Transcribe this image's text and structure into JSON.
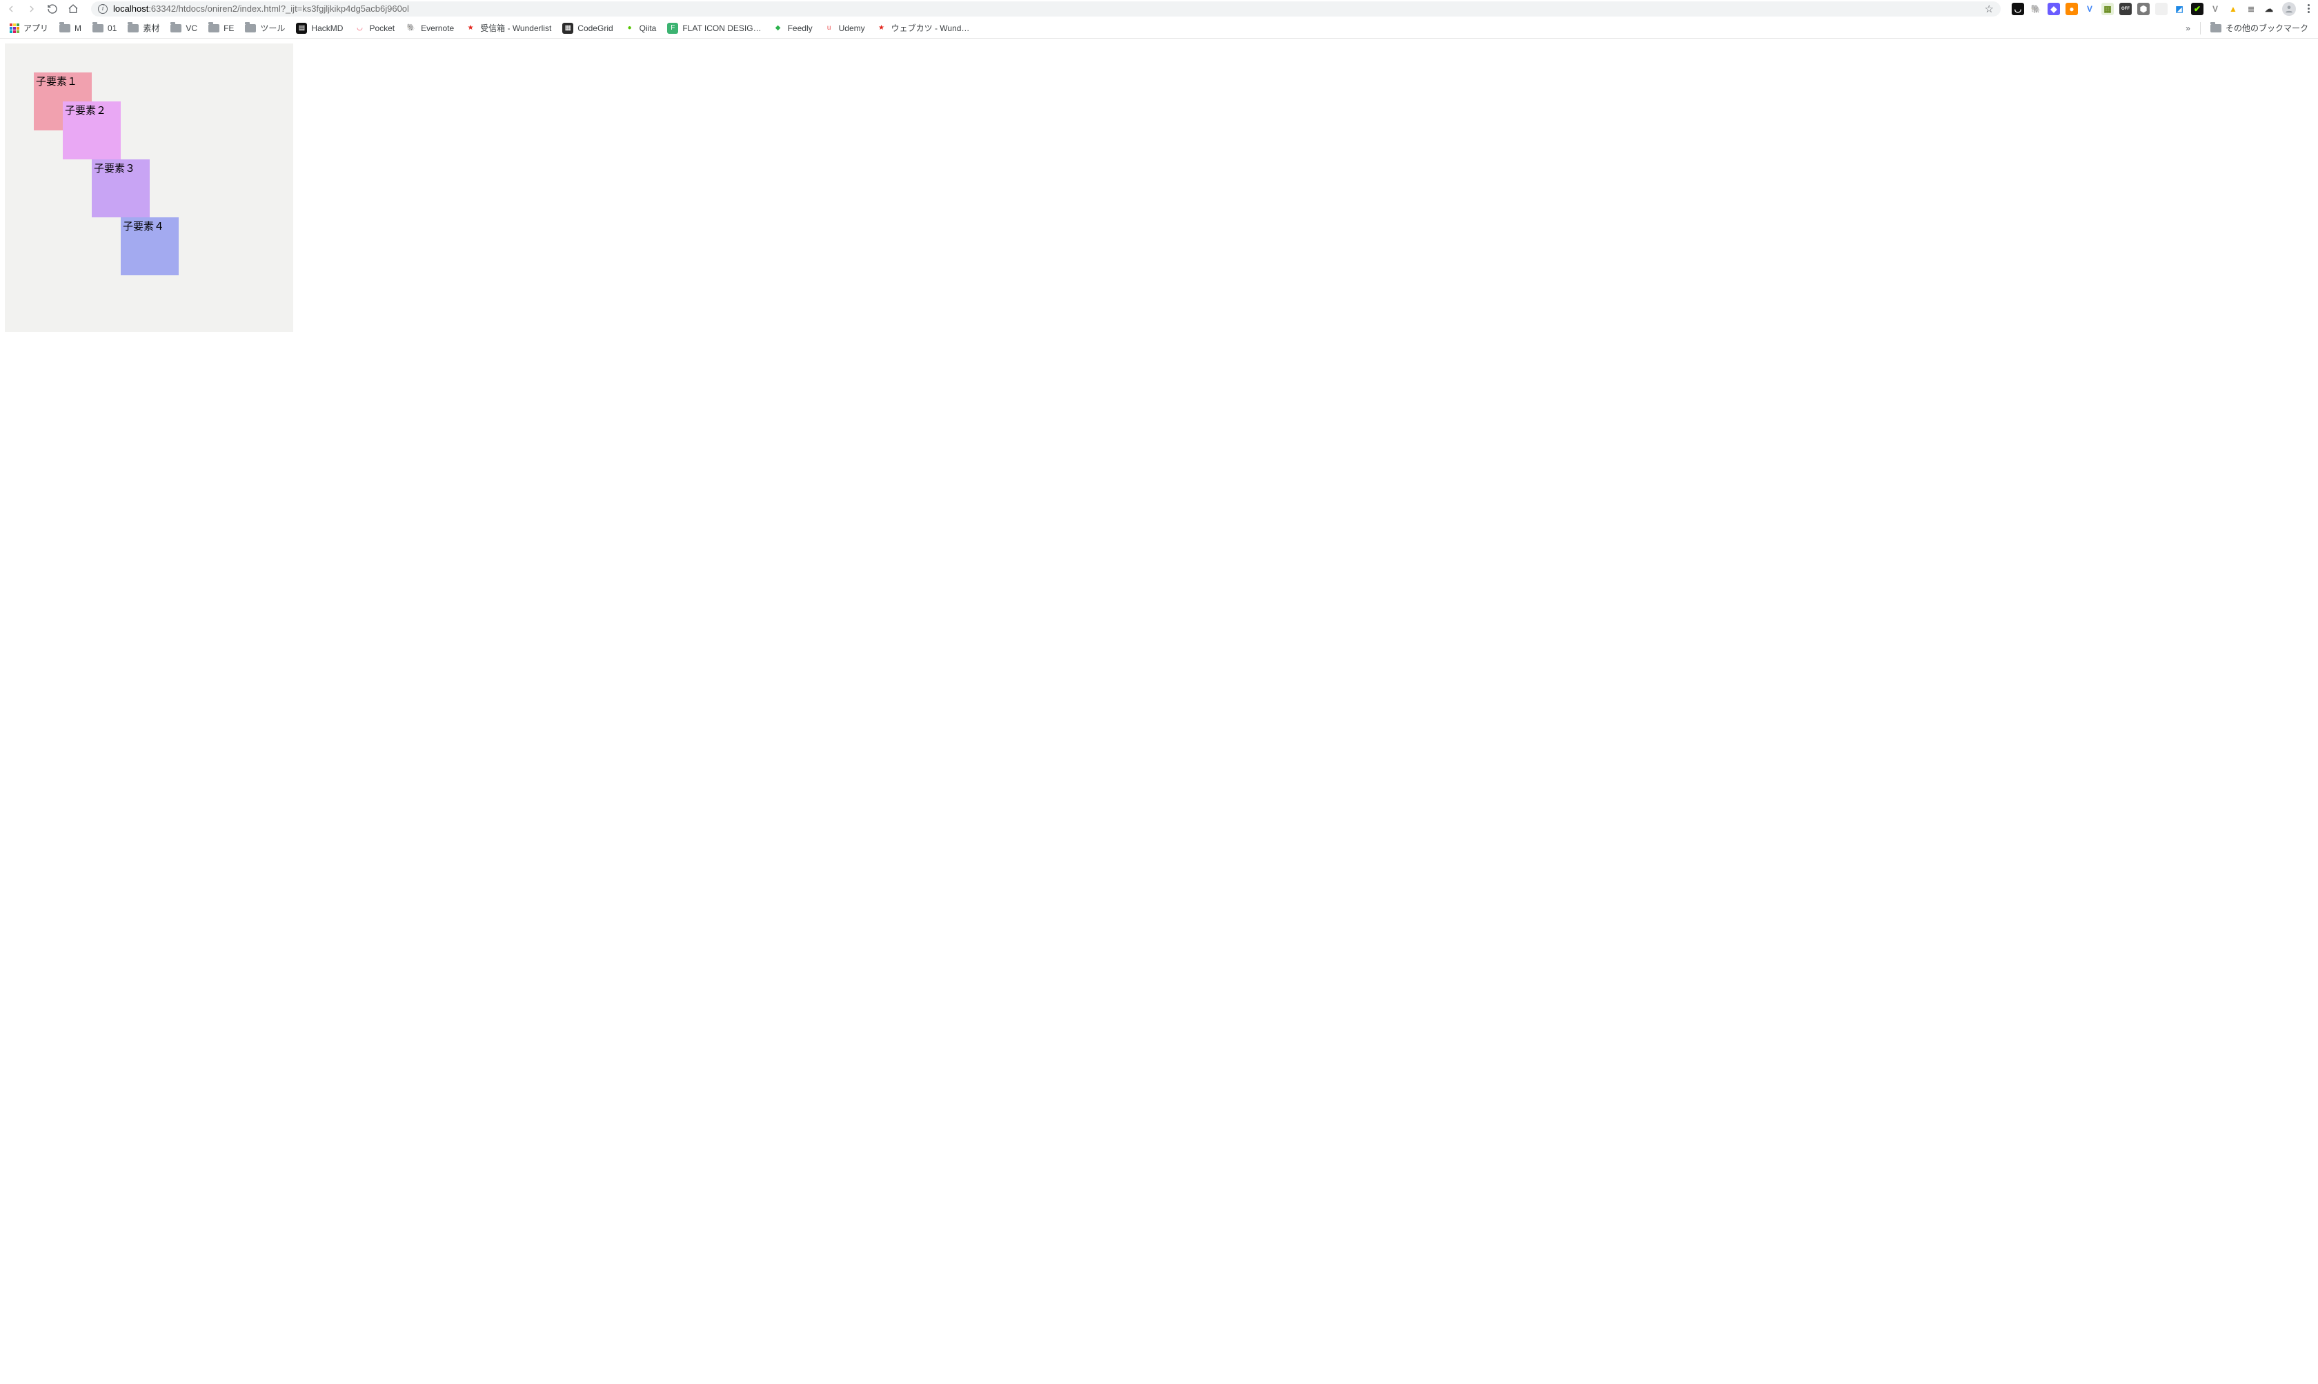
{
  "toolbar": {
    "address_bold": "localhost",
    "address_rest": ":63342/htdocs/oniren2/index.html?_ijt=ks3fgjljkikp4dg5acb6j960ol"
  },
  "extensions": [
    {
      "name": "pocket",
      "bg": "#101010",
      "glyph": "◡"
    },
    {
      "name": "evernote",
      "bg": "#ffffff",
      "glyph": "🐘",
      "fg": "#2dbe60"
    },
    {
      "name": "cube",
      "bg": "#6a5cff",
      "glyph": "◆"
    },
    {
      "name": "fox",
      "bg": "#ff8a00",
      "glyph": "●"
    },
    {
      "name": "v1",
      "bg": "#ffffff",
      "glyph": "V",
      "fg": "#3b82f6"
    },
    {
      "name": "calendar",
      "bg": "#e6f0d8",
      "glyph": "▦",
      "fg": "#6b8e23"
    },
    {
      "name": "off",
      "bg": "#3a3a3a",
      "glyph": "OFF"
    },
    {
      "name": "hex",
      "bg": "#7a7a7a",
      "glyph": "⬢"
    },
    {
      "name": "blank",
      "bg": "#f0f0f0",
      "glyph": ""
    },
    {
      "name": "note",
      "bg": "#ffffff",
      "glyph": "◩",
      "fg": "#1e88e5"
    },
    {
      "name": "check",
      "bg": "#111111",
      "glyph": "✔",
      "fg": "#7fff00"
    },
    {
      "name": "v2",
      "bg": "#ffffff",
      "glyph": "V",
      "fg": "#888888"
    },
    {
      "name": "drive",
      "bg": "#ffffff",
      "glyph": "▲",
      "fg": "#f4b400"
    },
    {
      "name": "lines",
      "bg": "#ffffff",
      "glyph": "≣",
      "fg": "#888888"
    },
    {
      "name": "cloud",
      "bg": "#ffffff",
      "glyph": "☁",
      "fg": "#333333"
    }
  ],
  "bookmarks": {
    "apps_label": "アプリ",
    "items": [
      {
        "type": "folder",
        "label": "M"
      },
      {
        "type": "folder",
        "label": "01"
      },
      {
        "type": "folder",
        "label": "素材"
      },
      {
        "type": "folder",
        "label": "VC"
      },
      {
        "type": "folder",
        "label": "FE"
      },
      {
        "type": "folder",
        "label": "ツール"
      },
      {
        "type": "icon",
        "label": "HackMD",
        "bg": "#111111",
        "fg": "#ffffff",
        "glyph": "▤"
      },
      {
        "type": "icon",
        "label": "Pocket",
        "bg": "#ffffff",
        "fg": "#ef4056",
        "glyph": "◡"
      },
      {
        "type": "icon",
        "label": "Evernote",
        "bg": "#ffffff",
        "fg": "#2dbe60",
        "glyph": "🐘"
      },
      {
        "type": "icon",
        "label": "受信箱 - Wunderlist",
        "bg": "#ffffff",
        "fg": "#e2231a",
        "glyph": "★"
      },
      {
        "type": "icon",
        "label": "CodeGrid",
        "bg": "#2b2b2b",
        "fg": "#ffffff",
        "glyph": "▦"
      },
      {
        "type": "icon",
        "label": "Qiita",
        "bg": "#ffffff",
        "fg": "#55c500",
        "glyph": "●"
      },
      {
        "type": "icon",
        "label": "FLAT ICON DESIG…",
        "bg": "#3cb371",
        "fg": "#ffffff",
        "glyph": "F"
      },
      {
        "type": "icon",
        "label": "Feedly",
        "bg": "#ffffff",
        "fg": "#2bb24c",
        "glyph": "◆"
      },
      {
        "type": "icon",
        "label": "Udemy",
        "bg": "#ffffff",
        "fg": "#ec5252",
        "glyph": "u"
      },
      {
        "type": "icon",
        "label": "ウェブカツ - Wund…",
        "bg": "#ffffff",
        "fg": "#e2231a",
        "glyph": "★"
      }
    ],
    "overflow": "»",
    "other_label": "その他のブックマーク"
  },
  "page": {
    "children": [
      {
        "label": "子要素１"
      },
      {
        "label": "子要素２"
      },
      {
        "label": "子要素３"
      },
      {
        "label": "子要素４"
      }
    ]
  }
}
